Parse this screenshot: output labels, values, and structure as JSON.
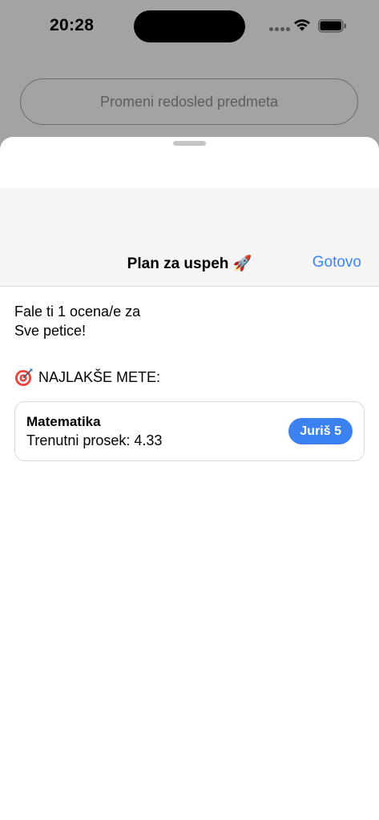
{
  "status_bar": {
    "time": "20:28",
    "icons": [
      "signal-dots-icon",
      "wifi-icon",
      "battery-icon"
    ]
  },
  "background": {
    "reorder_button_label": "Promeni redosled predmeta"
  },
  "sheet": {
    "title": "Plan za uspeh 🚀",
    "done_label": "Gotovo",
    "message_line_1": "Fale ti 1 ocena/e za",
    "message_line_2": "Sve petice!",
    "section_header": "NAJLAKŠE METE:",
    "section_icon": "target-icon",
    "targets": [
      {
        "subject": "Matematika",
        "average_text": "Trenutni prosek: 4.33",
        "action_label": "Juriš 5"
      }
    ]
  },
  "colors": {
    "accent": "#3b86f0",
    "button_fill": "#3b82f0",
    "dim_background": "#a3a3a3",
    "nav_background": "#f5f5f5"
  }
}
